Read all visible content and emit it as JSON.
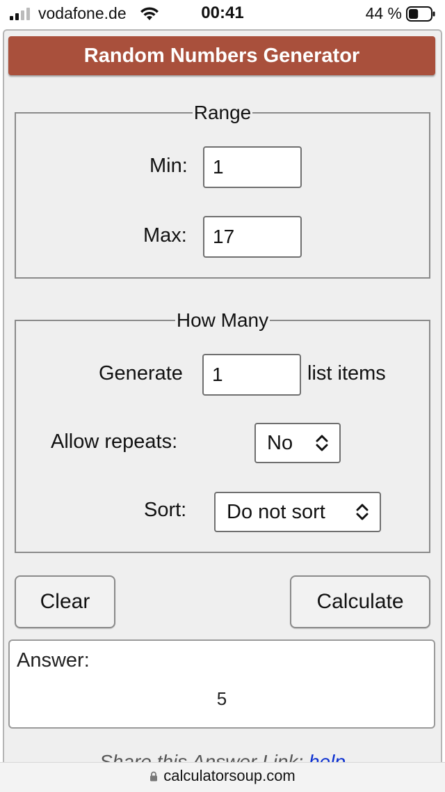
{
  "status_bar": {
    "carrier": "vodafone.de",
    "time": "00:41",
    "battery_percent": "44 %",
    "battery_level": 0.44
  },
  "calculator": {
    "title": "Random Numbers Generator",
    "range": {
      "legend": "Range",
      "min_label": "Min:",
      "min_value": "1",
      "max_label": "Max:",
      "max_value": "17"
    },
    "how_many": {
      "legend": "How Many",
      "generate_label": "Generate",
      "generate_value": "1",
      "generate_suffix": "list items",
      "repeats_label": "Allow repeats:",
      "repeats_value": "No",
      "sort_label": "Sort:",
      "sort_value": "Do not sort"
    },
    "buttons": {
      "clear": "Clear",
      "calculate": "Calculate"
    },
    "answer": {
      "label": "Answer:",
      "value": "5"
    },
    "share": {
      "text": "Share this Answer Link: ",
      "link_text": "help"
    }
  },
  "browser": {
    "url": "calculatorsoup.com"
  },
  "colors": {
    "title_bar": "#a9503c",
    "panel_bg": "#efefef",
    "link": "#0b2fd0"
  }
}
